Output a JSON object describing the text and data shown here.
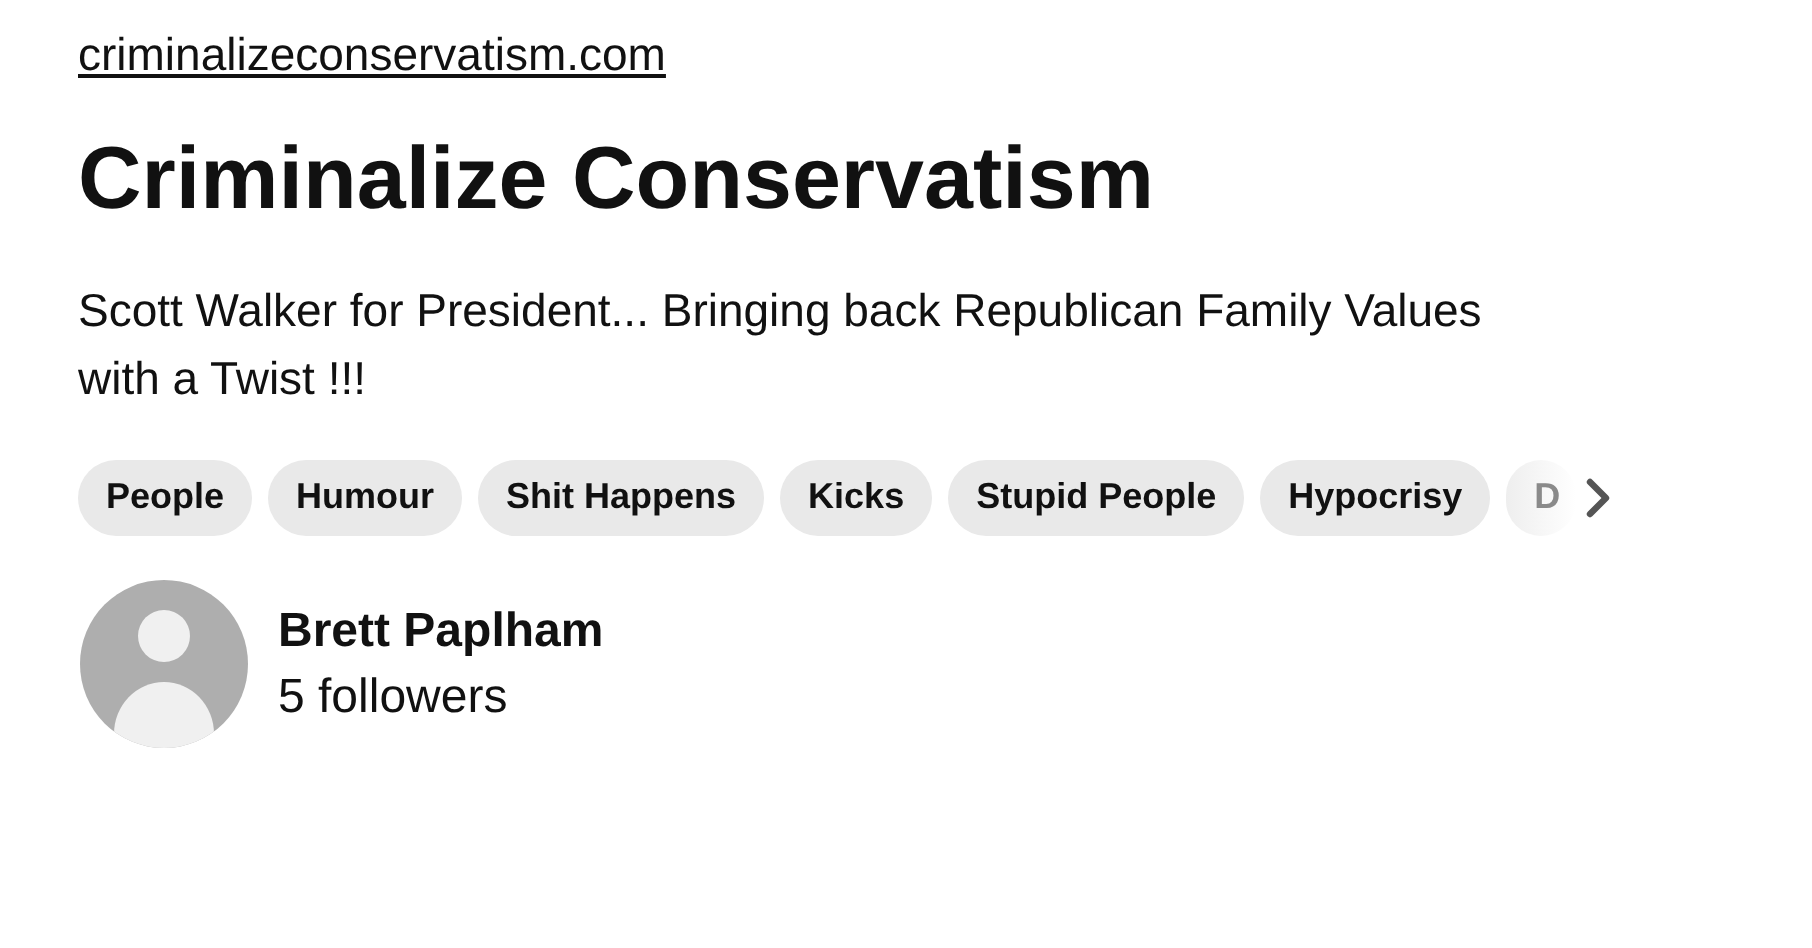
{
  "site_link": "criminalizeconservatism.com",
  "title": "Criminalize Conservatism",
  "description": "Scott Walker for President... Bringing back Republican Family Values with a Twist !!!",
  "tags": [
    {
      "label": "People",
      "cut": false
    },
    {
      "label": "Humour",
      "cut": false
    },
    {
      "label": "Shit Happens",
      "cut": false
    },
    {
      "label": "Kicks",
      "cut": false
    },
    {
      "label": "Stupid People",
      "cut": false
    },
    {
      "label": "Hypocrisy",
      "cut": false
    },
    {
      "label": "D",
      "cut": true
    }
  ],
  "owner": {
    "name": "Brett Paplham",
    "followers": "5 followers"
  }
}
